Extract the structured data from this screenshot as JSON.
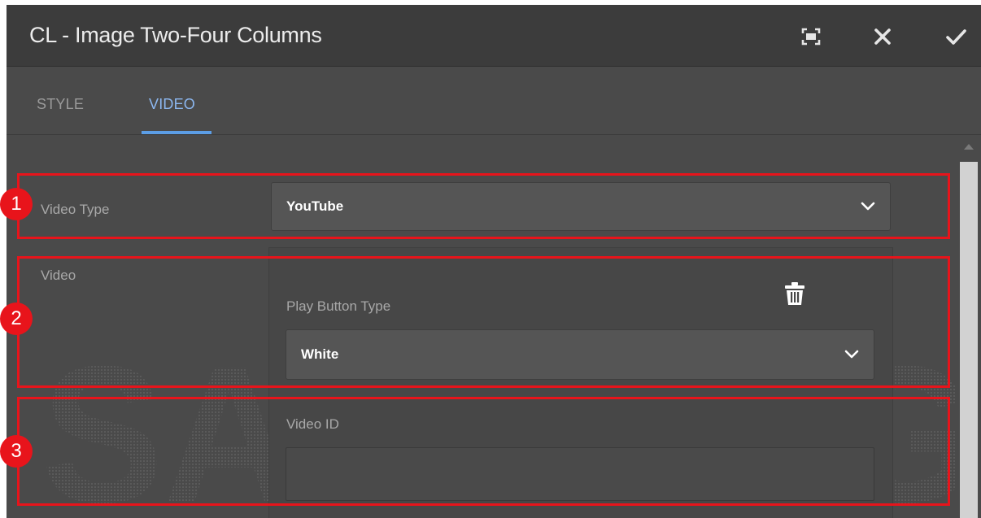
{
  "dialog": {
    "title": "CL - Image Two-Four Columns",
    "actions": [
      {
        "name": "fullscreen-icon"
      },
      {
        "name": "close-icon"
      },
      {
        "name": "checkmark-icon"
      }
    ]
  },
  "tabs": [
    {
      "label": "STYLE",
      "active": false
    },
    {
      "label": "VIDEO",
      "active": true
    }
  ],
  "form": {
    "video_type_label": "Video Type",
    "video_type_value": "YouTube",
    "video_label": "Video",
    "play_button_type_label": "Play Button Type",
    "play_button_type_value": "White",
    "video_id_label": "Video ID",
    "video_id_value": ""
  },
  "annotations": [
    "1",
    "2",
    "3"
  ],
  "watermark": "SAMSUNG",
  "colors": {
    "dialog_bg": "#4a4a4a",
    "titlebar_bg": "#3c3c3c",
    "active_tab": "#5c9ee6",
    "highlight": "#e8141b"
  }
}
